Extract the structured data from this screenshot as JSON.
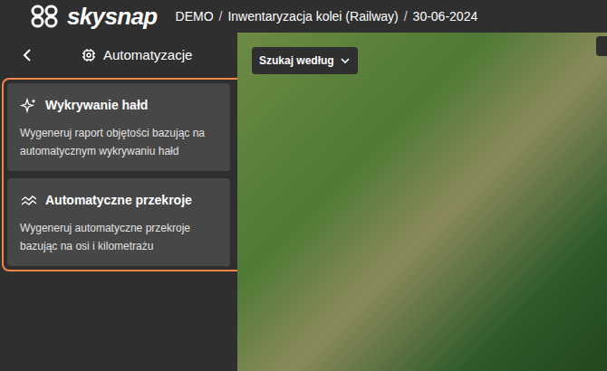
{
  "header": {
    "logo": "skysnap",
    "breadcrumb": [
      "DEMO",
      "Inwentaryzacja kolei (Railway)",
      "30-06-2024"
    ],
    "separator": "/"
  },
  "panel": {
    "title": "Automatyzacje",
    "cards_highlighted": true,
    "cards": [
      {
        "title": "Wykrywanie hałd",
        "description": "Wygeneruj raport objętości bazując na automatycznym wykrywaniu hałd"
      },
      {
        "title": "Automatyczne przekroje",
        "description": "Wygeneruj automatyczne przekroje bazując na osi i kilometrażu"
      }
    ]
  },
  "map": {
    "search_dropdown": "Szukaj według"
  }
}
